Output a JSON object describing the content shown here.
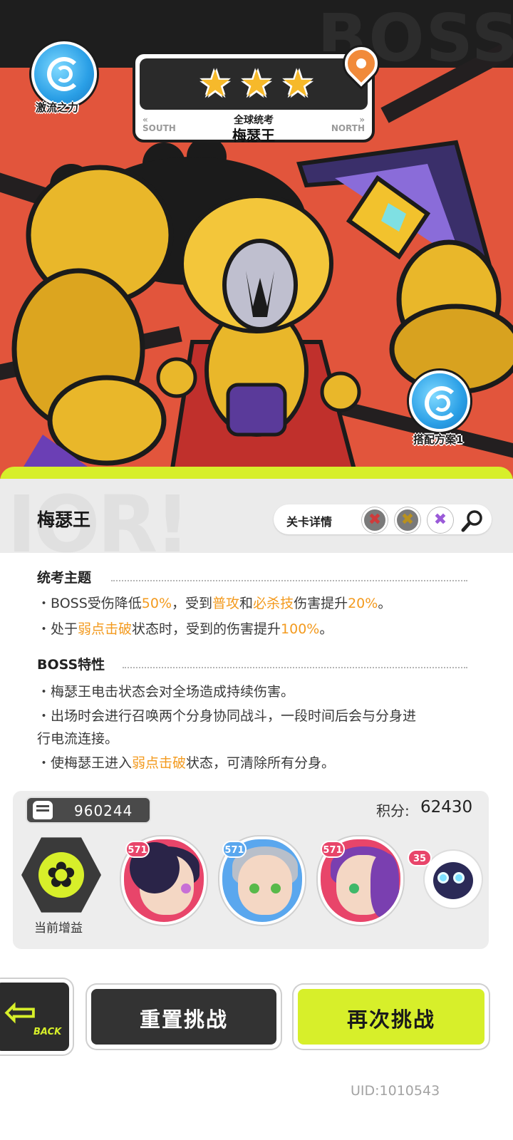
{
  "hero": {
    "element_badge": {
      "icon": "vortex-icon",
      "label": "激流之力",
      "color": "#2a9fe6"
    },
    "team_badge": {
      "icon": "vortex-icon",
      "label": "搭配方案1"
    },
    "watermark": "BOSS",
    "title_card": {
      "stars": 3,
      "star_color": "#f6b92b",
      "mode": "全球统考",
      "boss_name": "梅瑟王",
      "prev_label": "SOUTH",
      "next_label": "NORTH"
    },
    "location_pin_icon": "map-pin-icon"
  },
  "header": {
    "boss_name": "梅瑟王",
    "level_detail_label": "关卡详情",
    "chips": [
      {
        "icon": "x-icon",
        "color": "#cf3b3b"
      },
      {
        "icon": "x-icon",
        "color": "#b9911e"
      },
      {
        "icon": "x-icon",
        "color": "#9a5ad8"
      }
    ],
    "search_icon": "magnifier-icon",
    "accent": "#d7ef2a"
  },
  "rules": {
    "theme_title": "统考主题",
    "theme_lines": [
      {
        "p1": "・BOSS受伤降低",
        "h1": "50%",
        "p2": "，受到",
        "h2": "普攻",
        "p3": "和",
        "h3": "必杀技",
        "p4": "伤害提升",
        "h4": "20%",
        "p5": "。"
      },
      {
        "p1": "・处于",
        "h1": "弱点击破",
        "p2": "状态时，受到的伤害提升",
        "h2": "100%",
        "p3": "。"
      }
    ],
    "boss_title": "BOSS特性",
    "boss_lines": {
      "l1": "・梅瑟王电击状态会对全场造成持续伤害。",
      "l2a": "・出场时会进行召唤两个分身协同战斗，一段时间后会与分身进",
      "l2b": "行电流连接。",
      "l3": {
        "p1": "・使梅瑟王进入",
        "h1": "弱点击破",
        "p2": "状态，可清除所有分身。"
      }
    },
    "highlight_color": "#f39a1e"
  },
  "stats": {
    "power_icon": "fist-icon",
    "power": "960244",
    "score_label": "积分:",
    "score_value": "62430",
    "buff_label": "当前增益",
    "buff_icon": "flower-icon",
    "team": [
      {
        "level": "571",
        "hair": "#2a2448",
        "eye": "#c86fd6",
        "frame": "#e8456a"
      },
      {
        "level": "571",
        "hair": "#b8bfca",
        "eye": "#58b94a",
        "frame": "#5aa7ee"
      },
      {
        "level": "571",
        "hair": "#7a3fb0",
        "eye": "#3fb86a",
        "frame": "#e8456a"
      }
    ],
    "pet": {
      "level": "35",
      "name_icon": "cat-pet-icon"
    }
  },
  "buttons": {
    "back_label": "BACK",
    "reset_label": "重置挑战",
    "retry_label": "再次挑战"
  },
  "footer": {
    "uid": "UID:1010543"
  }
}
